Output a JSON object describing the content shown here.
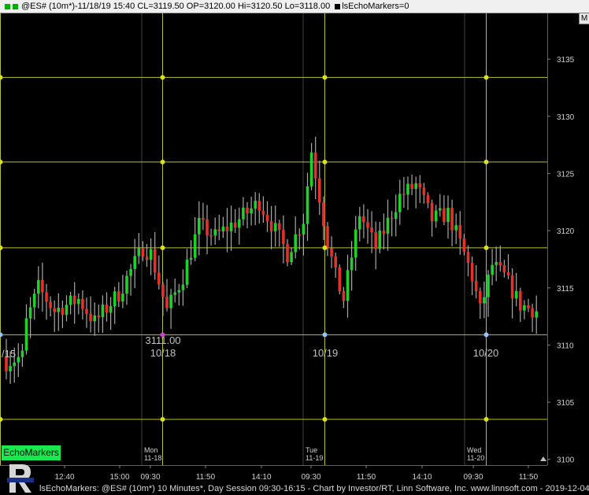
{
  "window": {
    "symbol_line": "@ES# (10m*)-11/18/19 15:40 CL=3119.50 OP=3120.00 Hi=3120.50 Lo=3118.00",
    "indicator_label": "lsEchoMarkers=0",
    "menu_button_label": "M"
  },
  "badge": {
    "label": "EchoMarkers"
  },
  "status": {
    "text": "lsEchoMarkers: @ES# (10m*) 10 Minutes*, Day Session 09:30-16:15 - Chart by Investor/RT, Linn Software, Inc. www.linnsoft.com - 2019-12-04"
  },
  "colors": {
    "background": "#000000",
    "grid_yellow": "#b8c230",
    "grid_gray": "#404040",
    "up_bar": "#1fd22a",
    "down_bar": "#e8302a",
    "wick": "#a8a8a8",
    "marker_yellow": "#d8e020",
    "marker_blue": "#8ec8ff",
    "marker_magenta": "#d040d0",
    "axis_text": "#d0d0d0"
  },
  "chart_data": {
    "type": "candlestick",
    "y_axis": {
      "ylim": [
        3099.5,
        3139
      ],
      "ticks": [
        3100,
        3105,
        3110,
        3115,
        3120,
        3125,
        3130,
        3135
      ]
    },
    "x_axis": {
      "tick_labels": [
        "12:40",
        "15:00",
        "09:30",
        "11:50",
        "14:10",
        "09:30",
        "11:50",
        "14:10",
        "09:30",
        "11:50"
      ],
      "session_labels": [
        {
          "day": "Mon",
          "date": "11-18"
        },
        {
          "day": "Tue",
          "date": "11-19"
        },
        {
          "day": "Wed",
          "date": "11-20"
        }
      ]
    },
    "horizontal_levels": [
      3103.5,
      3110.9,
      3118.5,
      3126.0,
      3133.4
    ],
    "annotations": [
      {
        "text": "/15",
        "price": 3109.1
      },
      {
        "text": "3111.00",
        "price": 3110.0
      },
      {
        "text": "10/18",
        "price": 3109.1
      },
      {
        "text": "10/19",
        "price": 3109.1
      },
      {
        "text": "10/20",
        "price": 3109.1
      }
    ],
    "bar_count": 133,
    "anchors": [
      [
        0,
        3108.5
      ],
      [
        4,
        3109
      ],
      [
        5,
        3112
      ],
      [
        8,
        3115
      ],
      [
        12,
        3113
      ],
      [
        18,
        3114
      ],
      [
        22,
        3112
      ],
      [
        28,
        3114.5
      ],
      [
        34,
        3118.5
      ],
      [
        36,
        3118
      ],
      [
        40,
        3113
      ],
      [
        44,
        3116
      ],
      [
        48,
        3120.5
      ],
      [
        52,
        3119.5
      ],
      [
        58,
        3121
      ],
      [
        63,
        3122.5
      ],
      [
        67,
        3120
      ],
      [
        70,
        3118
      ],
      [
        74,
        3121
      ],
      [
        76,
        3127
      ],
      [
        78,
        3123
      ],
      [
        80,
        3119
      ],
      [
        82,
        3116
      ],
      [
        84,
        3114
      ],
      [
        88,
        3121.5
      ],
      [
        92,
        3118.5
      ],
      [
        98,
        3123
      ],
      [
        102,
        3124
      ],
      [
        106,
        3121
      ],
      [
        110,
        3121.5
      ],
      [
        114,
        3118
      ],
      [
        116,
        3116
      ],
      [
        118,
        3113
      ],
      [
        121,
        3117
      ],
      [
        124,
        3116
      ],
      [
        128,
        3113.5
      ],
      [
        132,
        3113
      ]
    ]
  }
}
